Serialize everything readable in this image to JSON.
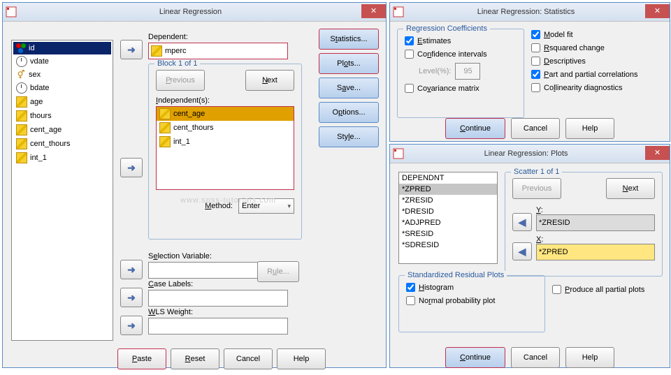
{
  "main": {
    "title": "Linear Regression",
    "vars": [
      {
        "name": "id",
        "icon": "circles",
        "selected": true
      },
      {
        "name": "vdate",
        "icon": "clock"
      },
      {
        "name": "sex",
        "icon": "venus"
      },
      {
        "name": "bdate",
        "icon": "clock"
      },
      {
        "name": "age",
        "icon": "ruler"
      },
      {
        "name": "thours",
        "icon": "ruler"
      },
      {
        "name": "cent_age",
        "icon": "ruler"
      },
      {
        "name": "cent_thours",
        "icon": "ruler"
      },
      {
        "name": "int_1",
        "icon": "ruler"
      }
    ],
    "dep_label": "Dependent:",
    "dep_value": "mperc",
    "block_label": "Block 1 of 1",
    "prev_label": "Previous",
    "next_label": "Next",
    "indep_label": "Independent(s):",
    "indep_items": [
      {
        "name": "cent_age",
        "hl": true
      },
      {
        "name": "cent_thours"
      },
      {
        "name": "int_1"
      }
    ],
    "method_label": "Method:",
    "method_value": "Enter",
    "selvar_label": "Selection Variable:",
    "rule_label": "Rule...",
    "caselabels_label": "Case Labels:",
    "wls_label": "WLS Weight:",
    "side": {
      "stats": "Statistics...",
      "plots": "Plots...",
      "save": "Save...",
      "options": "Options...",
      "style": "Style..."
    },
    "buttons": {
      "paste": "Paste",
      "reset": "Reset",
      "cancel": "Cancel",
      "help": "Help"
    },
    "watermark": "www.spss-tutorials.com"
  },
  "stats": {
    "title": "Linear Regression: Statistics",
    "group1": "Regression Coefficients",
    "estimates": "Estimates",
    "ci": "Confidence intervals",
    "level_label": "Level(%):",
    "level_value": "95",
    "cov": "Covariance matrix",
    "modelfit": "Model fit",
    "r2": "R squared change",
    "desc": "Descriptives",
    "part": "Part and partial correlations",
    "coll": "Collinearity diagnostics",
    "continue": "Continue",
    "cancel": "Cancel",
    "help": "Help"
  },
  "plots": {
    "title": "Linear Regression: Plots",
    "list": [
      "DEPENDNT",
      "*ZPRED",
      "*ZRESID",
      "*DRESID",
      "*ADJPRED",
      "*SRESID",
      "*SDRESID"
    ],
    "selected": "*ZPRED",
    "scatter_label": "Scatter 1 of 1",
    "prev": "Previous",
    "next": "Next",
    "y_label": "Y:",
    "y_value": "*ZRESID",
    "x_label": "X:",
    "x_value": "*ZPRED",
    "stdres_label": "Standardized Residual Plots",
    "hist": "Histogram",
    "npp": "Normal probability plot",
    "produce": "Produce all partial plots",
    "continue": "Continue",
    "cancel": "Cancel",
    "help": "Help"
  }
}
